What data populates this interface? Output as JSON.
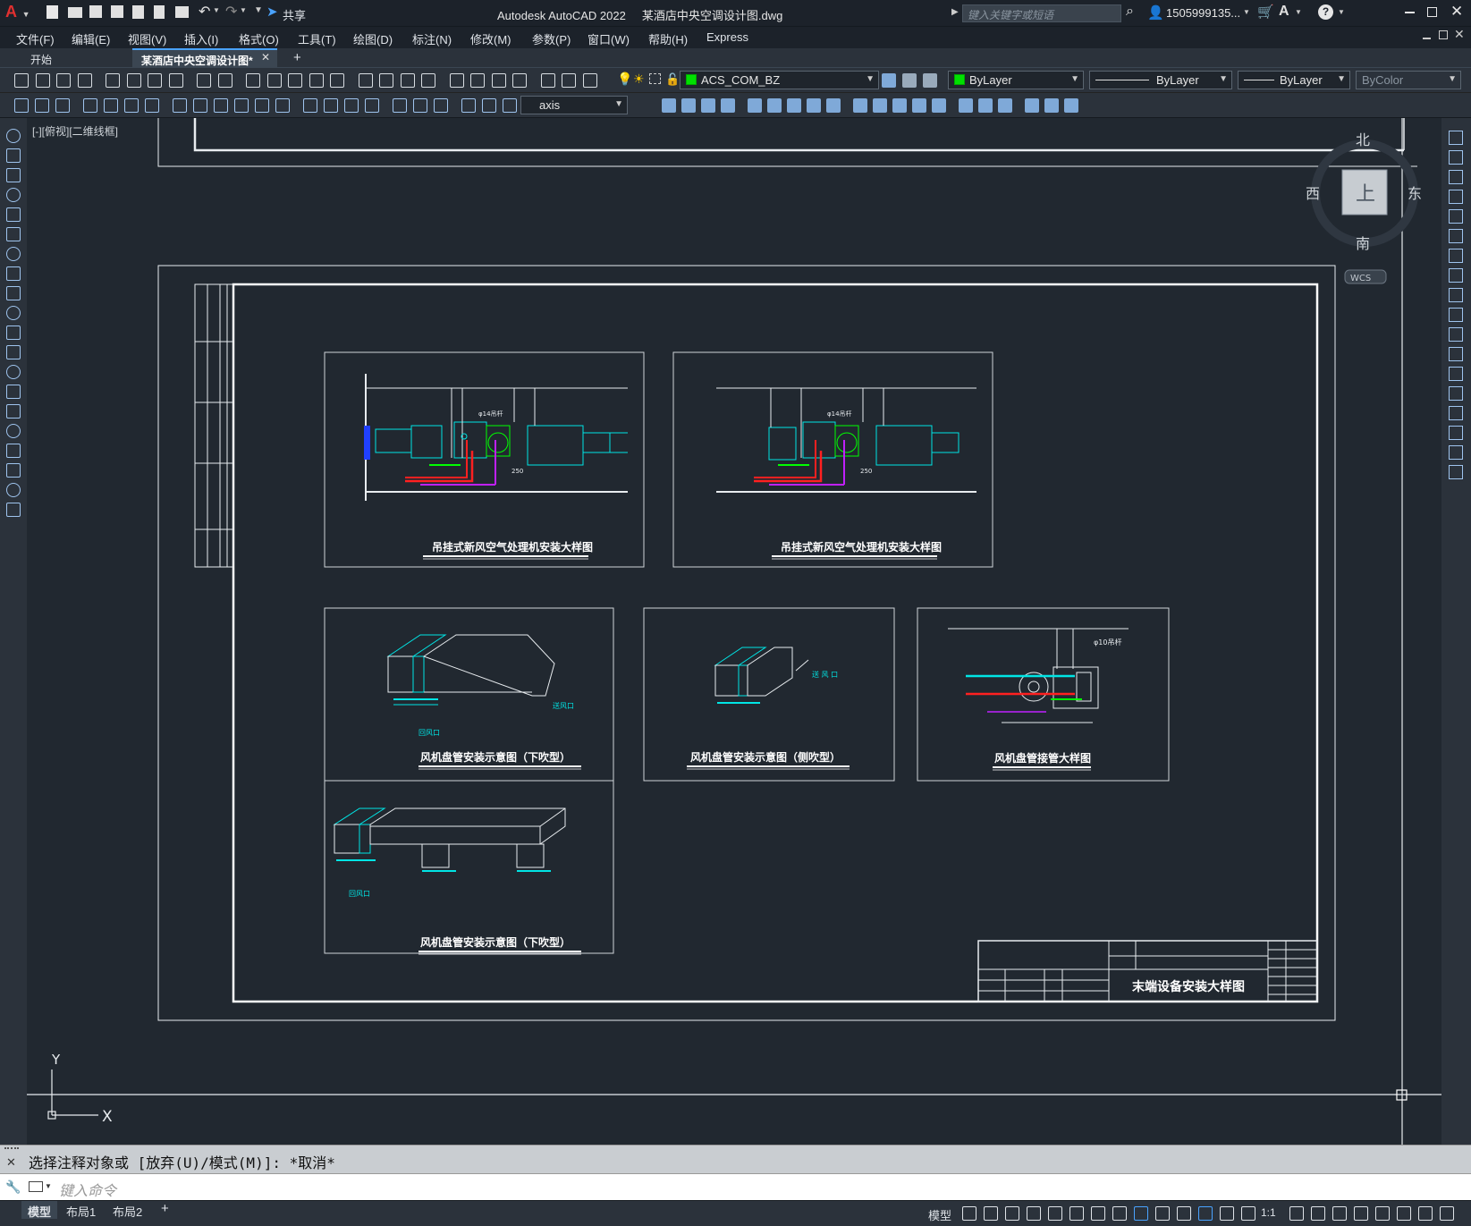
{
  "app": {
    "title": "Autodesk AutoCAD 2022",
    "document": "某酒店中央空调设计图.dwg",
    "search_placeholder": "键入关键字或短语",
    "user": "1505999135...",
    "share_label": "共享",
    "app_letter": "A"
  },
  "menu": [
    "文件(F)",
    "编辑(E)",
    "视图(V)",
    "插入(I)",
    "格式(O)",
    "工具(T)",
    "绘图(D)",
    "标注(N)",
    "修改(M)",
    "参数(P)",
    "窗口(W)",
    "帮助(H)",
    "Express"
  ],
  "tabs": {
    "start": "开始",
    "active": "某酒店中央空调设计图*",
    "add": "+"
  },
  "toolbar": {
    "layer_name": "ACS_COM_BZ",
    "color": "ByLayer",
    "linetype": "ByLayer",
    "lineweight": "ByLayer",
    "plotstyle": "ByColor",
    "dimstyle": "axis"
  },
  "viewport": {
    "label": "[-][俯视][二维线框]"
  },
  "viewcube": {
    "north": "北",
    "south": "南",
    "east": "东",
    "west": "西",
    "top": "上",
    "wcs": "WCS"
  },
  "ucs": {
    "x": "X",
    "y": "Y"
  },
  "drawing": {
    "panel1_caption": "吊挂式新风空气处理机安装大样图",
    "panel2_caption": "吊挂式新风空气处理机安装大样图",
    "panel3_caption": "风机盘管安装示意图（下吹型）",
    "panel4_caption": "风机盘管安装示意图（侧吹型）",
    "panel5_caption": "风机盘管接管大样图",
    "panel6_caption": "风机盘管安装示意图（下吹型）",
    "sheet_title": "末端设备安装大样图",
    "dim_250_a": "250",
    "dim_250_b": "250",
    "note_phi14_a": "φ14吊杆",
    "note_phi14_b": "φ14吊杆",
    "note_phi10": "φ10吊杆",
    "note_return": "回风口",
    "note_supply": "送风口",
    "note_return_b": "回风口",
    "note_sidesupply": "送 风 口"
  },
  "command": {
    "history": "选择注释对象或 [放弃(U)/模式(M)]: *取消*",
    "placeholder": "键入命令"
  },
  "layout_tabs": [
    "模型",
    "布局1",
    "布局2"
  ],
  "status": {
    "model": "模型",
    "scale": "1:1"
  },
  "colors": {
    "cyan": "#00e5e5",
    "green": "#00ff00",
    "red": "#ff2020",
    "magenta": "#c020ff",
    "blue": "#2040ff",
    "white": "#ffffff"
  }
}
